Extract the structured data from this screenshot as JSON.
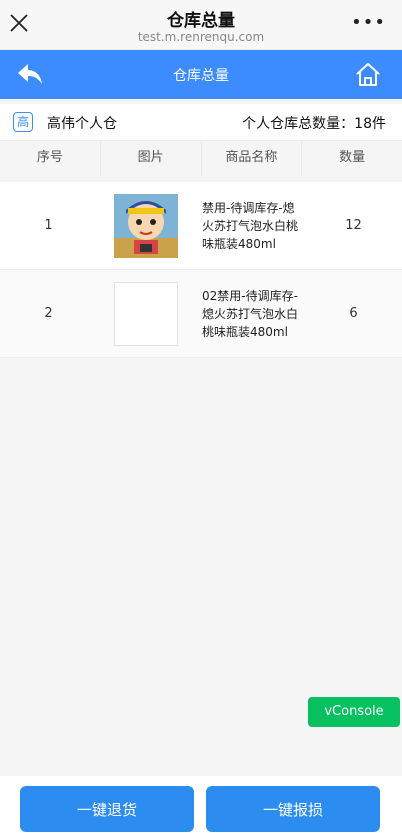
{
  "topbar": {
    "title": "仓库总量",
    "url": "test.m.renrenqu.com",
    "close_icon": "close-icon",
    "more_label": "•••"
  },
  "navbar": {
    "title": "仓库总量",
    "back_icon": "back-arrow-icon",
    "home_icon": "home-icon",
    "accent": "#3c8cff"
  },
  "warehouse": {
    "badge": "高",
    "name": "高伟个人仓",
    "total": "个人仓库总数量：18件"
  },
  "table": {
    "headers": [
      "序号",
      "图片",
      "商品名称",
      "数量"
    ],
    "rows": [
      {
        "index": "1",
        "image": "product-thumbnail-cartoon",
        "name": "禁用-待调库存-熄火苏打气泡水白桃味瓶装480ml",
        "qty": "12"
      },
      {
        "index": "2",
        "image": "product-thumbnail-empty",
        "name": "02禁用-待调库存-熄火苏打气泡水白桃味瓶装480ml",
        "qty": "6"
      }
    ]
  },
  "vconsole": {
    "label": "vConsole",
    "color": "#07c160"
  },
  "footer": {
    "return_label": "一键退货",
    "damage_label": "一键报损",
    "button_color": "#2d8cf0"
  }
}
